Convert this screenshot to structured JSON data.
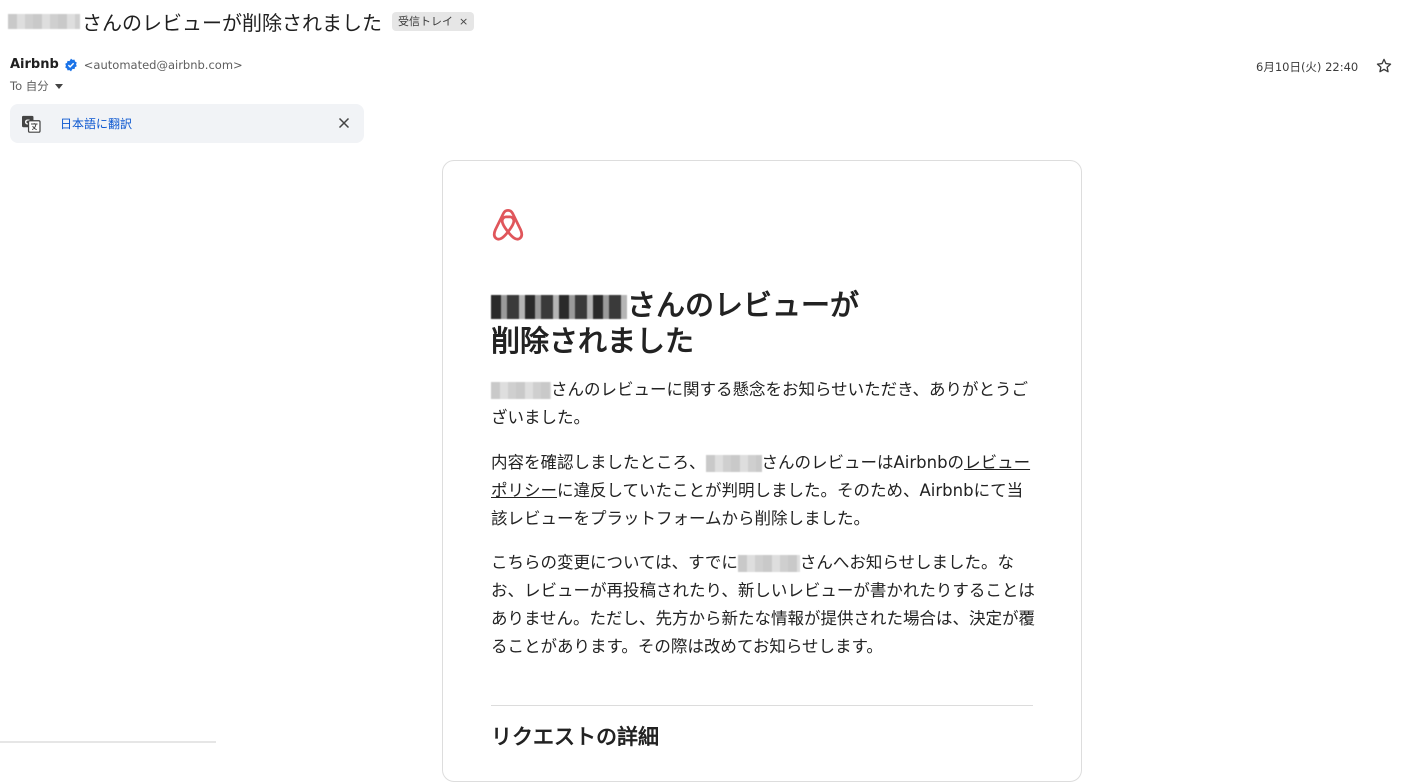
{
  "subject": {
    "text": "さんのレビューが削除されました",
    "label_chip": "受信トレイ",
    "chip_close": "×"
  },
  "sender": {
    "name": "Airbnb",
    "email": "<automated@airbnb.com>",
    "to_label": "To 自分",
    "date": "6月10日(火) 22:40"
  },
  "translate": {
    "link_label": "日本語に翻訳"
  },
  "email": {
    "headline_1": "さんのレビューが",
    "headline_2": "削除されました",
    "p1_text": "さんのレビューに関する懸念をお知らせいただき、ありがとうございました。",
    "p2_a": "内容を確認しましたところ、",
    "p2_b": "さんのレビューはAirbnbの",
    "p2_link": "レビューポリシー",
    "p2_c": "に違反していたことが判明しました。そのため、Airbnbにて当該レビューをプラットフォームから削除しました。",
    "p3_a": "こちらの変更については、すでに",
    "p3_b": "さんへお知らせしました。なお、レビューが再投稿されたり、新しいレビューが書かれたりすることはありません。ただし、先方から新たな情報が提供された場合は、決定が覆ることがあります。その際は改めてお知らせします。",
    "section_title": "リクエストの詳細"
  },
  "colors": {
    "brand": "#e0565b",
    "link": "#0b57d0",
    "verified": "#1a73e8"
  },
  "icons": [
    "verified-badge-icon",
    "chevron-down-icon",
    "star-icon",
    "translate-icon",
    "close-icon",
    "airbnb-logo-icon"
  ]
}
